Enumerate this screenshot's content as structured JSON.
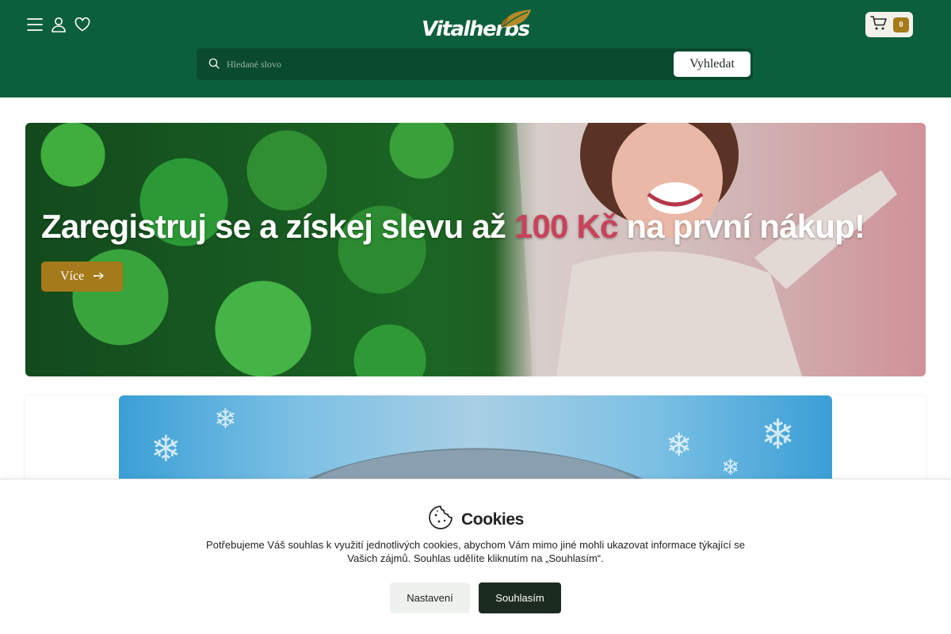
{
  "header": {
    "brand": "Vitalherbs",
    "icons": [
      "menu-icon",
      "user-icon",
      "heart-icon"
    ],
    "cart": {
      "count": "0",
      "icon": "cart-icon"
    },
    "search": {
      "placeholder": "Hledané slovo",
      "value": "",
      "button_label": "Vyhledat",
      "icon": "search-icon"
    }
  },
  "hero": {
    "title_before": "Zaregistruj se a získej slevu až ",
    "title_highlight": "100 Kč",
    "title_after": " na první nákup!",
    "button_label": "Více",
    "button_icon": "arrow-right-icon"
  },
  "cookies": {
    "title": "Cookies",
    "icon": "cookie-icon",
    "text": "Potřebujeme Váš souhlas k využití jednotlivých cookies, abychom Vám mimo jiné mohli ukazovat informace týkající se Vašich zájmů. Souhlas udělíte kliknutím na „Souhlasím“.",
    "settings_label": "Nastavení",
    "accept_label": "Souhlasím"
  },
  "colors": {
    "header_bg": "#0c5f3c",
    "search_bg": "#0a4b30",
    "accent_gold": "#a57a1a",
    "highlight_pink": "#c8435a",
    "accept_button": "#1c2b1f"
  }
}
